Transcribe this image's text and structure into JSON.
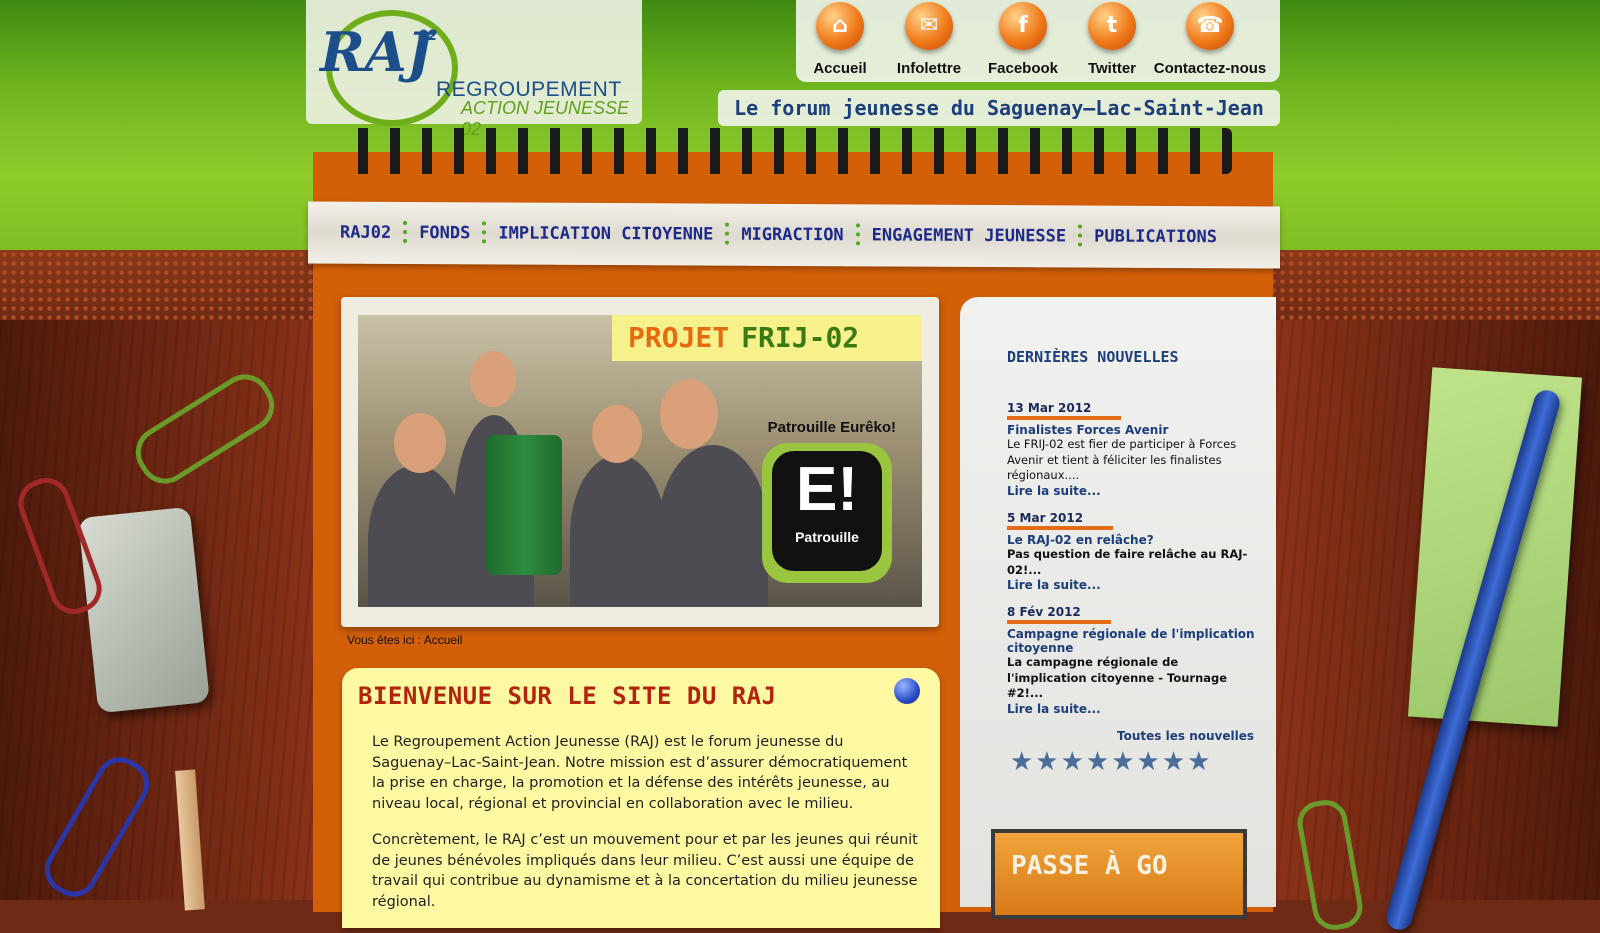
{
  "logo": {
    "mark": "RAJ",
    "number": "02",
    "line1": "REGROUPEMENT",
    "line2": "ACTION JEUNESSE 02"
  },
  "top_nav": [
    {
      "label": "Accueil",
      "icon": "home-icon"
    },
    {
      "label": "Infolettre",
      "icon": "mail-icon"
    },
    {
      "label": "Facebook",
      "icon": "facebook-icon"
    },
    {
      "label": "Twitter",
      "icon": "twitter-icon"
    },
    {
      "label": "Contactez-nous",
      "icon": "phone-icon"
    }
  ],
  "tagline": "Le forum jeunesse du Saguenay–Lac-Saint-Jean",
  "main_menu": [
    "RAJ02",
    "FONDS",
    "IMPLICATION CITOYENNE",
    "MIGRACTION",
    "ENGAGEMENT JEUNESSE",
    "PUBLICATIONS"
  ],
  "slideshow": {
    "heading_word1": "PROJET",
    "heading_word2": "FRIJ-02",
    "patrol_label": "Patrouille Eurêko!",
    "badge_letter": "E!",
    "badge_word": "Patrouille"
  },
  "breadcrumb": "Vous êtes ici : Accueil",
  "welcome": {
    "title": "BIENVENUE SUR LE SITE DU RAJ",
    "p1": "Le Regroupement Action Jeunesse (RAJ) est le forum jeunesse du Saguenay–Lac-Saint-Jean. Notre mission est d’assurer démocratiquement la prise en charge, la promotion et la défense des intérêts jeunesse, au niveau local, régional et provincial en collaboration avec le milieu.",
    "p2": "Concrètement, le RAJ c’est un mouvement pour et par les jeunes qui réunit de jeunes bénévoles impliqués dans leur milieu. C’est aussi une équipe de travail qui contribue au dynamisme et à la concertation du milieu jeunesse régional."
  },
  "news": {
    "heading": "DERNIÈRES NOUVELLES",
    "items": [
      {
        "date": "13 Mar 2012",
        "title": "Finalistes Forces Avenir",
        "text": "Le FRIJ-02 est fier de participer à Forces Avenir et tient à féliciter les finalistes régionaux....",
        "more": "Lire la suite..."
      },
      {
        "date": "5 Mar 2012",
        "title": "Le RAJ-02 en relâche?",
        "text": "Pas question de faire relâche au RAJ-02!...",
        "more": "Lire la suite..."
      },
      {
        "date": "8 Fév 2012",
        "title": "Campagne régionale de l'implication citoyenne",
        "text": "La campagne régionale de l'implication citoyenne - Tournage #2!...",
        "more": "Lire la suite..."
      }
    ],
    "all_link": "Toutes les nouvelles",
    "stars": "★★★★★★★★"
  },
  "banner": {
    "text": "PASSE À GO"
  },
  "colors": {
    "accent_orange": "#d35f09",
    "brand_blue": "#1c3e7a",
    "brand_green": "#6fae1a",
    "welcome_bg": "#fcf9a2",
    "welcome_title": "#b3240f"
  }
}
